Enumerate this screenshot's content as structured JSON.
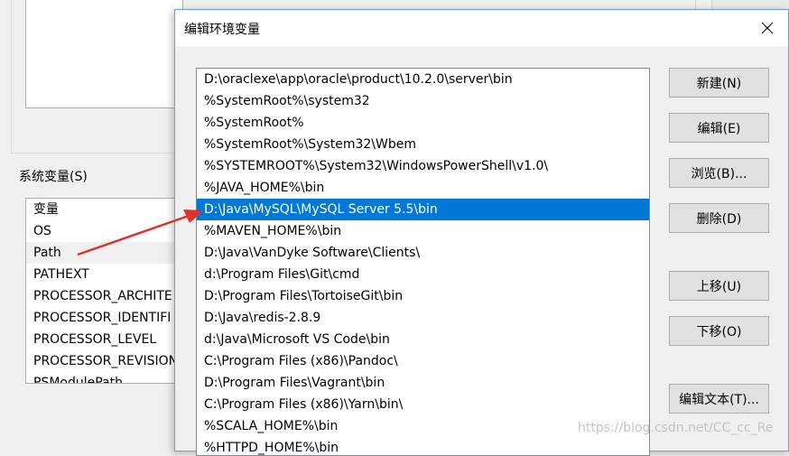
{
  "dialog": {
    "title": "编辑环境变量",
    "selected_index": 6,
    "paths": [
      "D:\\oraclexe\\app\\oracle\\product\\10.2.0\\server\\bin",
      "%SystemRoot%\\system32",
      "%SystemRoot%",
      "%SystemRoot%\\System32\\Wbem",
      "%SYSTEMROOT%\\System32\\WindowsPowerShell\\v1.0\\",
      "%JAVA_HOME%\\bin",
      "D:\\Java\\MySQL\\MySQL Server 5.5\\bin",
      "%MAVEN_HOME%\\bin",
      "D:\\Java\\VanDyke Software\\Clients\\",
      "d:\\Program Files\\Git\\cmd",
      "D:\\Program Files\\TortoiseGit\\bin",
      "D:\\Java\\redis-2.8.9",
      "d:\\Java\\Microsoft VS Code\\bin",
      "C:\\Program Files (x86)\\Pandoc\\",
      "D:\\Program Files\\Vagrant\\bin",
      "C:\\Program Files (x86)\\Yarn\\bin\\",
      "%SCALA_HOME%\\bin",
      "%HTTPD_HOME%\\bin"
    ],
    "buttons": {
      "new": "新建(N)",
      "edit": "编辑(E)",
      "browse": "浏览(B)...",
      "delete": "删除(D)",
      "move_up": "上移(U)",
      "move_down": "下移(O)",
      "edit_text": "编辑文本(T)..."
    }
  },
  "background": {
    "group_label": "系统变量(S)",
    "variables": [
      "变量",
      "OS",
      "Path",
      "PATHEXT",
      "PROCESSOR_ARCHITE",
      "PROCESSOR_IDENTIFI",
      "PROCESSOR_LEVEL",
      "PROCESSOR_REVISION",
      "PSModulePath"
    ]
  },
  "watermark": "https://blog.csdn.net/CC_cc_Re",
  "colors": {
    "selection": "#0078d7",
    "annotation_arrow": "#e0302a"
  }
}
